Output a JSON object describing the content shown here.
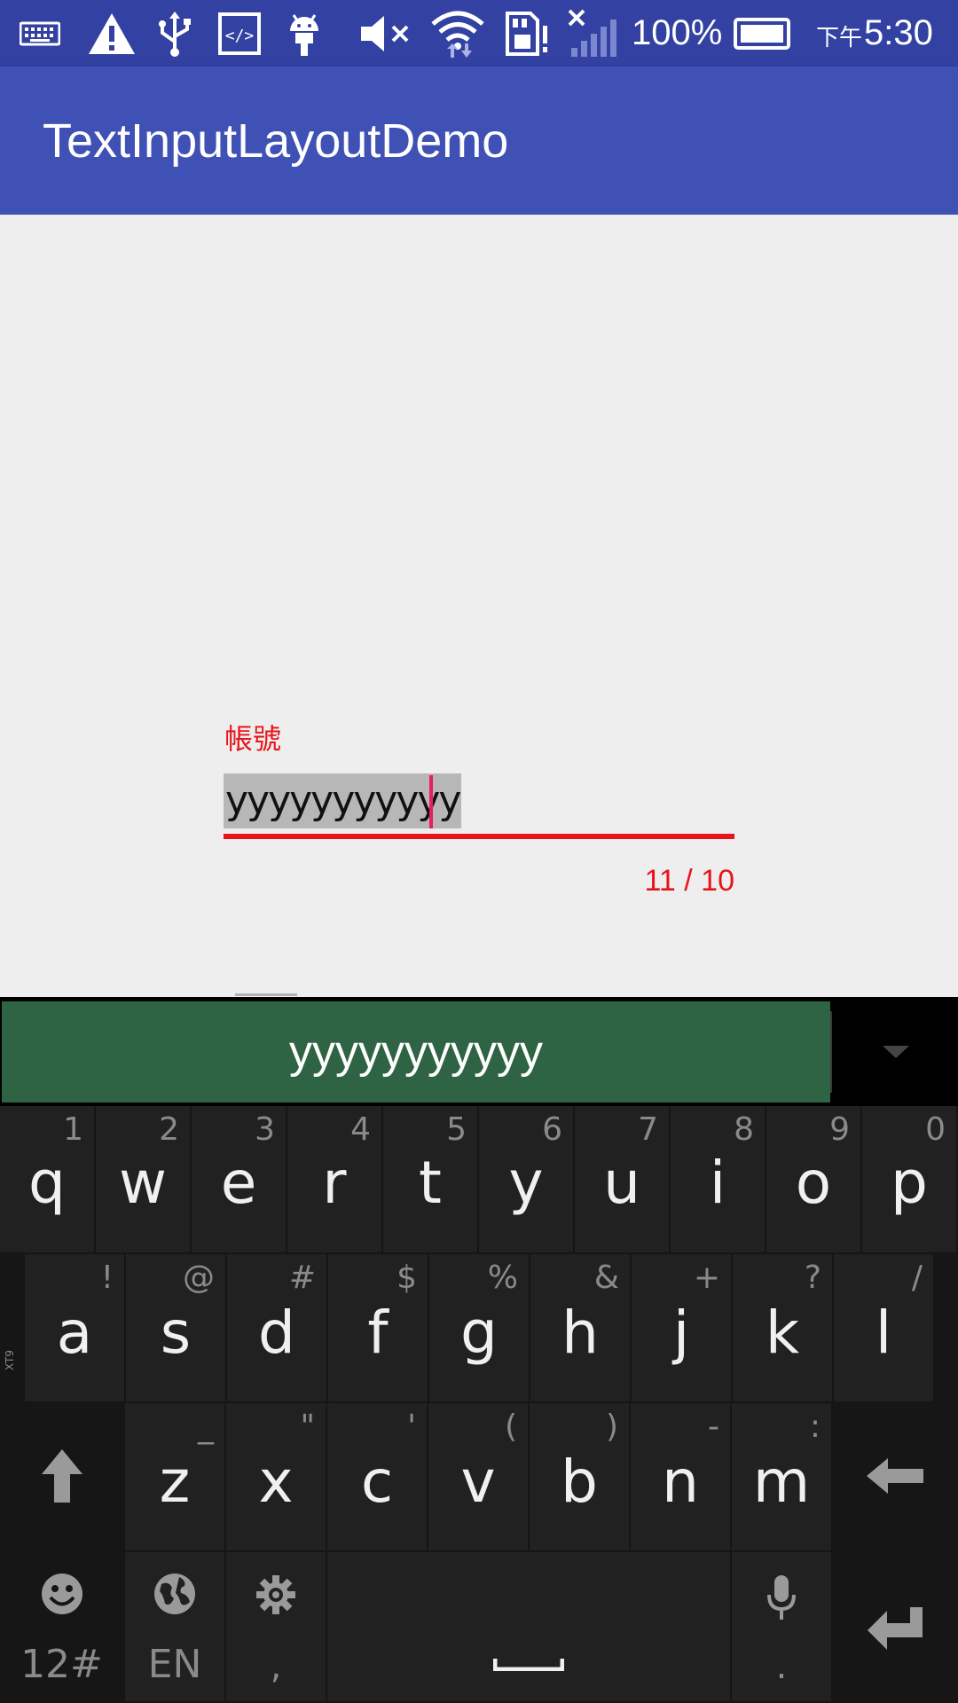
{
  "status_bar": {
    "battery_percent": "100%",
    "time_prefix": "下午",
    "time": "5:30",
    "icons": [
      "keyboard-icon",
      "warning-icon",
      "usb-icon",
      "code-icon",
      "android-icon",
      "mute-icon",
      "wifi-icon",
      "sd-card-icon",
      "no-signal-icon",
      "battery-icon"
    ],
    "bg_color": "#3341a2"
  },
  "app_bar": {
    "title": "TextInputLayoutDemo",
    "bg_color": "#3f51b5"
  },
  "form": {
    "account_label": "帳號",
    "account_value": "yyyyyyyyyyy",
    "counter": "11 / 10",
    "error_color": "#e8141c"
  },
  "keyboard": {
    "suggestion": "yyyyyyyyyyy",
    "row1": [
      {
        "main": "q",
        "hint": "1"
      },
      {
        "main": "w",
        "hint": "2"
      },
      {
        "main": "e",
        "hint": "3"
      },
      {
        "main": "r",
        "hint": "4"
      },
      {
        "main": "t",
        "hint": "5"
      },
      {
        "main": "y",
        "hint": "6"
      },
      {
        "main": "u",
        "hint": "7"
      },
      {
        "main": "i",
        "hint": "8"
      },
      {
        "main": "o",
        "hint": "9"
      },
      {
        "main": "p",
        "hint": "0"
      }
    ],
    "row2": [
      {
        "main": "a",
        "hint": "!"
      },
      {
        "main": "s",
        "hint": "@"
      },
      {
        "main": "d",
        "hint": "#"
      },
      {
        "main": "f",
        "hint": "$"
      },
      {
        "main": "g",
        "hint": "%"
      },
      {
        "main": "h",
        "hint": "&"
      },
      {
        "main": "j",
        "hint": "+"
      },
      {
        "main": "k",
        "hint": "?"
      },
      {
        "main": "l",
        "hint": "/"
      }
    ],
    "row3": [
      {
        "main": "z",
        "hint": "_"
      },
      {
        "main": "x",
        "hint": "\""
      },
      {
        "main": "c",
        "hint": "'"
      },
      {
        "main": "v",
        "hint": "("
      },
      {
        "main": "b",
        "hint": ")"
      },
      {
        "main": "n",
        "hint": "-"
      },
      {
        "main": "m",
        "hint": ":"
      }
    ],
    "xt9_label": "XT9",
    "symbols_label": "12#",
    "language_label": "EN",
    "comma_label": ",",
    "period_label": "."
  }
}
